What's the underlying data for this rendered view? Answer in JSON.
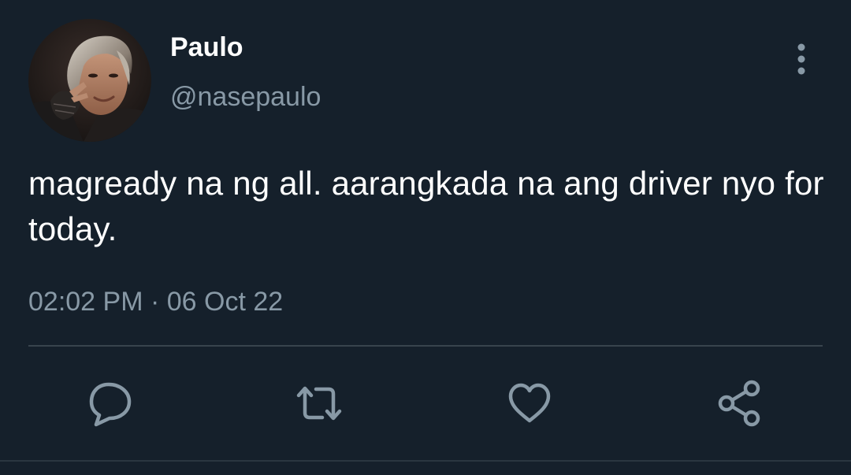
{
  "tweet": {
    "author": {
      "display_name": "Paulo",
      "handle": "@nasepaulo",
      "avatar_icon": "profile-photo"
    },
    "text": "magready na ng all. aarangkada na ang driver nyo for today.",
    "timestamp": "02:02 PM · 06 Oct 22"
  },
  "actions": {
    "reply_icon": "reply-icon",
    "retweet_icon": "retweet-icon",
    "like_icon": "like-icon",
    "share_icon": "share-icon",
    "more_icon": "more-vertical-icon"
  },
  "colors": {
    "background": "#15202b",
    "primary_text": "#ffffff",
    "secondary_text": "#8899a6",
    "divider": "#38444d"
  }
}
